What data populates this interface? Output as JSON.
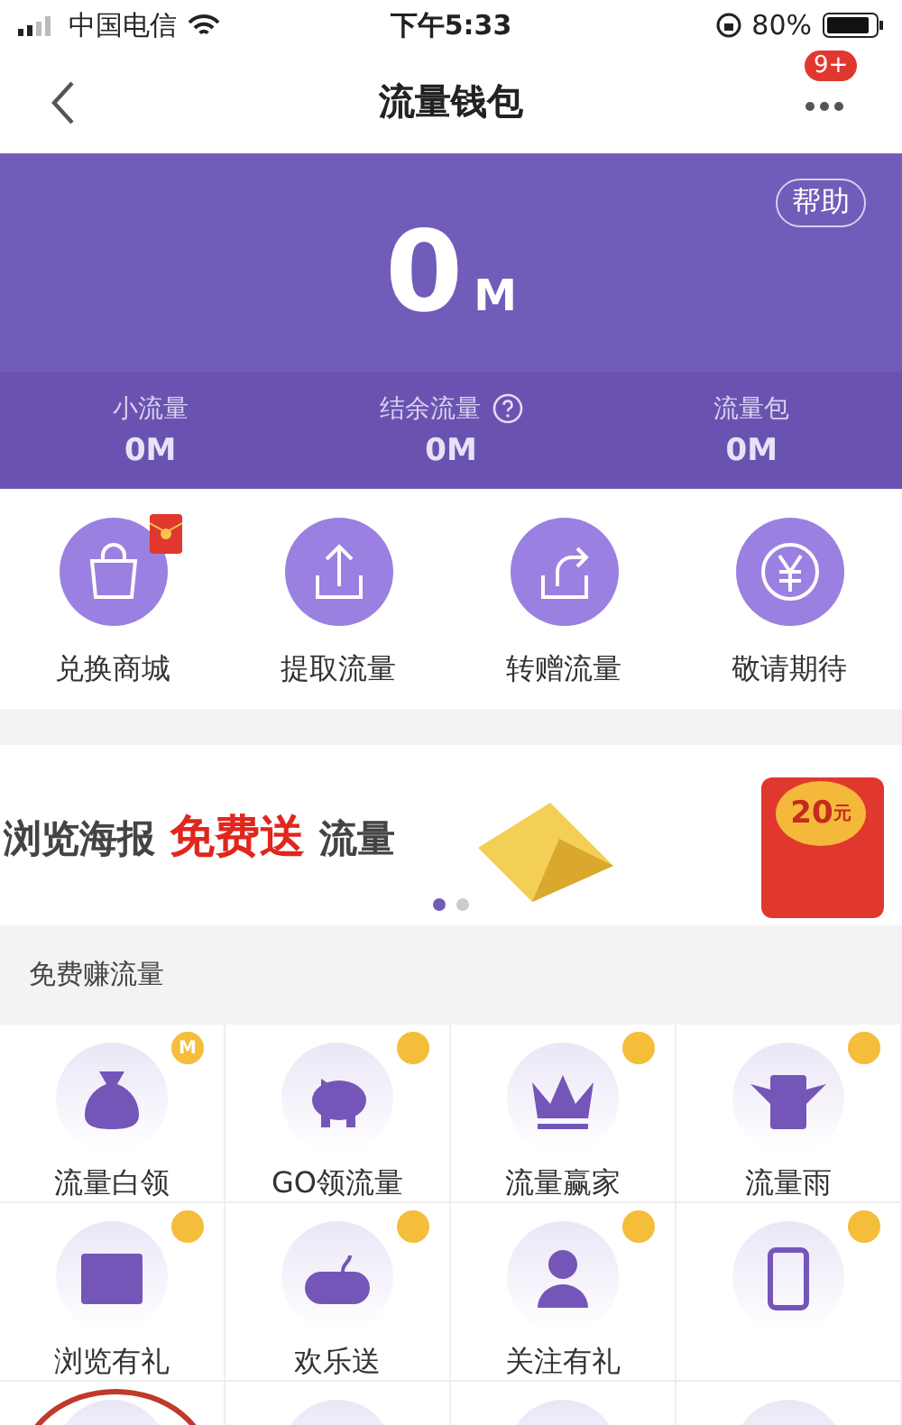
{
  "status_bar": {
    "carrier": "中国电信",
    "time": "下午5:33",
    "battery": "80%"
  },
  "nav": {
    "title": "流量钱包",
    "badge": "9+"
  },
  "hero": {
    "help": "帮助",
    "amount": "0",
    "unit": "M"
  },
  "stats": [
    {
      "label": "小流量",
      "value": "0M",
      "info": false
    },
    {
      "label": "结余流量",
      "value": "0M",
      "info": true
    },
    {
      "label": "流量包",
      "value": "0M",
      "info": false
    }
  ],
  "actions": [
    {
      "kind": "bag",
      "label": "兑换商城",
      "tag": true
    },
    {
      "kind": "upload",
      "label": "提取流量",
      "tag": false
    },
    {
      "kind": "share",
      "label": "转赠流量",
      "tag": false
    },
    {
      "kind": "yen",
      "label": "敬请期待",
      "tag": false
    }
  ],
  "banner": {
    "lead": "浏览海报",
    "highlight": "免费送",
    "tail": "流量",
    "amount": "20",
    "unit": "元",
    "dots": [
      {
        "selected": true
      },
      {
        "selected": false
      }
    ]
  },
  "section": {
    "title": "免费赚流量"
  },
  "grid": [
    {
      "kind": "bag",
      "label": "流量白领",
      "badge": "M"
    },
    {
      "kind": "piggy",
      "label": "GO领流量"
    },
    {
      "kind": "crown",
      "label": "流量赢家"
    },
    {
      "kind": "envelope",
      "label": "流量雨"
    },
    {
      "kind": "browser",
      "label": "浏览有礼"
    },
    {
      "kind": "gamepad",
      "label": "欢乐送"
    },
    {
      "kind": "person",
      "label": "关注有礼"
    },
    {
      "kind": "phone"
    },
    {
      "kind": "cut",
      "circled": true
    },
    {
      "kind": "cut",
      "circled": false
    },
    {
      "kind": "cut",
      "circled": false
    },
    {
      "kind": "cut",
      "circled": false
    }
  ]
}
